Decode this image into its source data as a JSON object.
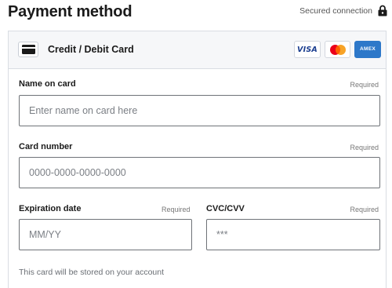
{
  "header": {
    "title": "Payment method",
    "secure_text": "Secured connection",
    "secure_icon": "lock-icon"
  },
  "method": {
    "icon": "credit-card-icon",
    "label": "Credit / Debit Card",
    "brands": {
      "visa": "VISA",
      "mastercard": "mastercard-logo",
      "amex": "AMEX"
    }
  },
  "fields": {
    "name": {
      "label": "Name on card",
      "required": "Required",
      "value": "",
      "placeholder": "Enter name on card here"
    },
    "number": {
      "label": "Card number",
      "required": "Required",
      "value": "",
      "placeholder": "0000-0000-0000-0000"
    },
    "expiry": {
      "label": "Expiration date",
      "required": "Required",
      "value": "",
      "placeholder": "MM/YY"
    },
    "cvc": {
      "label": "CVC/CVV",
      "required": "Required",
      "value": "",
      "placeholder": "***"
    }
  },
  "note": "This card will be stored on your account",
  "colors": {
    "mastercard_red": "#eb001b",
    "mastercard_yellow": "#f79e1b",
    "amex_blue": "#2d78c9",
    "visa_blue": "#1a3d8f"
  }
}
